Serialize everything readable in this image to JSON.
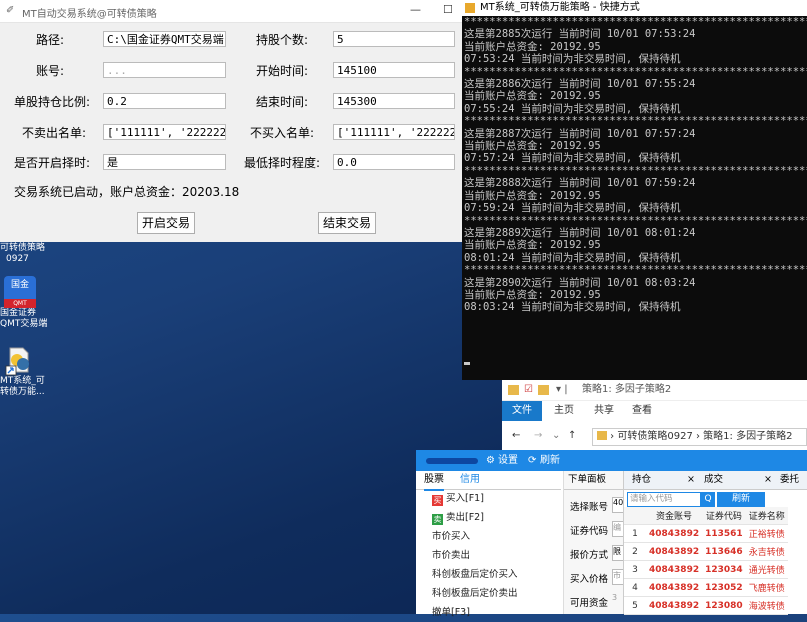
{
  "app": {
    "title": "MT自动交易系统@可转债策略",
    "minimize": "—",
    "maximize": "☐",
    "fields": [
      {
        "label": "路径:",
        "value": "C:\\国金证券QMT交易端"
      },
      {
        "label": "持股个数:",
        "value": "5"
      },
      {
        "label": "账号:",
        "value": "..."
      },
      {
        "label": "开始时间:",
        "value": "145100"
      },
      {
        "label": "单股持仓比例:",
        "value": "0.2"
      },
      {
        "label": "结束时间:",
        "value": "145300"
      },
      {
        "label": "不卖出名单:",
        "value": "['111111', '222222']"
      },
      {
        "label": "不买入名单:",
        "value": "['111111', '222222']"
      },
      {
        "label": "是否开启择时:",
        "value": "是"
      },
      {
        "label": "最低择时程度:",
        "value": "0.0"
      }
    ],
    "status": "交易系统已启动，账户总资金：20203.18",
    "start_button": "开启交易",
    "stop_button": "结束交易"
  },
  "desktop": {
    "icons": [
      {
        "label1": "可转债策略",
        "label2": "0927"
      },
      {
        "tile": "国金",
        "tile2": "QMT",
        "label1": "国金证券",
        "label2": "QMT交易端"
      },
      {
        "label1": "MT系统_可",
        "label2": "转债万能..."
      }
    ]
  },
  "console": {
    "title": "MT系统_可转债万能策略 - 快捷方式",
    "lines": [
      "********************************************************",
      "这是第2885次运行 当前时间 10/01 07:53:24",
      "当前账户总资金: 20192.95",
      "07:53:24 当前时间为非交易时间, 保持待机",
      "********************************************************",
      "这是第2886次运行 当前时间 10/01 07:55:24",
      "当前账户总资金: 20192.95",
      "07:55:24 当前时间为非交易时间, 保持待机",
      "********************************************************",
      "这是第2887次运行 当前时间 10/01 07:57:24",
      "当前账户总资金: 20192.95",
      "07:57:24 当前时间为非交易时间, 保持待机",
      "********************************************************",
      "这是第2888次运行 当前时间 10/01 07:59:24",
      "当前账户总资金: 20192.95",
      "07:59:24 当前时间为非交易时间, 保持待机",
      "********************************************************",
      "这是第2889次运行 当前时间 10/01 08:01:24",
      "当前账户总资金: 20192.95",
      "08:01:24 当前时间为非交易时间, 保持待机",
      "********************************************************",
      "这是第2890次运行 当前时间 10/01 08:03:24",
      "当前账户总资金: 20192.95",
      "08:03:24 当前时间为非交易时间, 保持待机"
    ]
  },
  "explorer": {
    "title": "策略1: 多因子策略2",
    "file_tab": "文件",
    "tabs": [
      "主页",
      "共享",
      "查看"
    ],
    "path1": "可转债策略0927",
    "path2": "策略1: 多因子策略2"
  },
  "trade": {
    "settings": "设置",
    "refresh": "刷新",
    "tabs": [
      "股票",
      "信用"
    ],
    "menu": [
      {
        "badge": "买",
        "label": "买入[F1]",
        "color": "#e53935"
      },
      {
        "badge": "卖",
        "label": "卖出[F2]",
        "color": "#2e9e46"
      },
      {
        "badge": "",
        "label": "市价买入",
        "color": ""
      },
      {
        "badge": "",
        "label": "市价卖出",
        "color": ""
      },
      {
        "badge": "",
        "label": "科创板盘后定价买入",
        "color": ""
      },
      {
        "badge": "",
        "label": "科创板盘后定价卖出",
        "color": ""
      },
      {
        "badge": "",
        "label": "撤单[F3]",
        "color": ""
      }
    ],
    "form_tab": "下单面板",
    "form_labels": [
      "选择账号",
      "证券代码",
      "报价方式",
      "买入价格",
      "可用资金"
    ],
    "form_values": [
      "40",
      "编",
      "限",
      "市",
      "3"
    ],
    "grid_tabs": [
      "持仓",
      "成交",
      "委托"
    ],
    "search_placeholder": "请输入代码",
    "search_btn": "Q",
    "refresh_btn": "刷新",
    "columns": [
      "",
      "资金账号",
      "证券代码",
      "证券名称"
    ],
    "rows": [
      {
        "no": "1",
        "account": "40843892",
        "code": "113561",
        "name": "正裕转债"
      },
      {
        "no": "2",
        "account": "40843892",
        "code": "113646",
        "name": "永吉转债"
      },
      {
        "no": "3",
        "account": "40843892",
        "code": "123034",
        "name": "通光转债"
      },
      {
        "no": "4",
        "account": "40843892",
        "code": "123052",
        "name": "飞鹿转债"
      },
      {
        "no": "5",
        "account": "40843892",
        "code": "123080",
        "name": "海波转债"
      }
    ]
  }
}
